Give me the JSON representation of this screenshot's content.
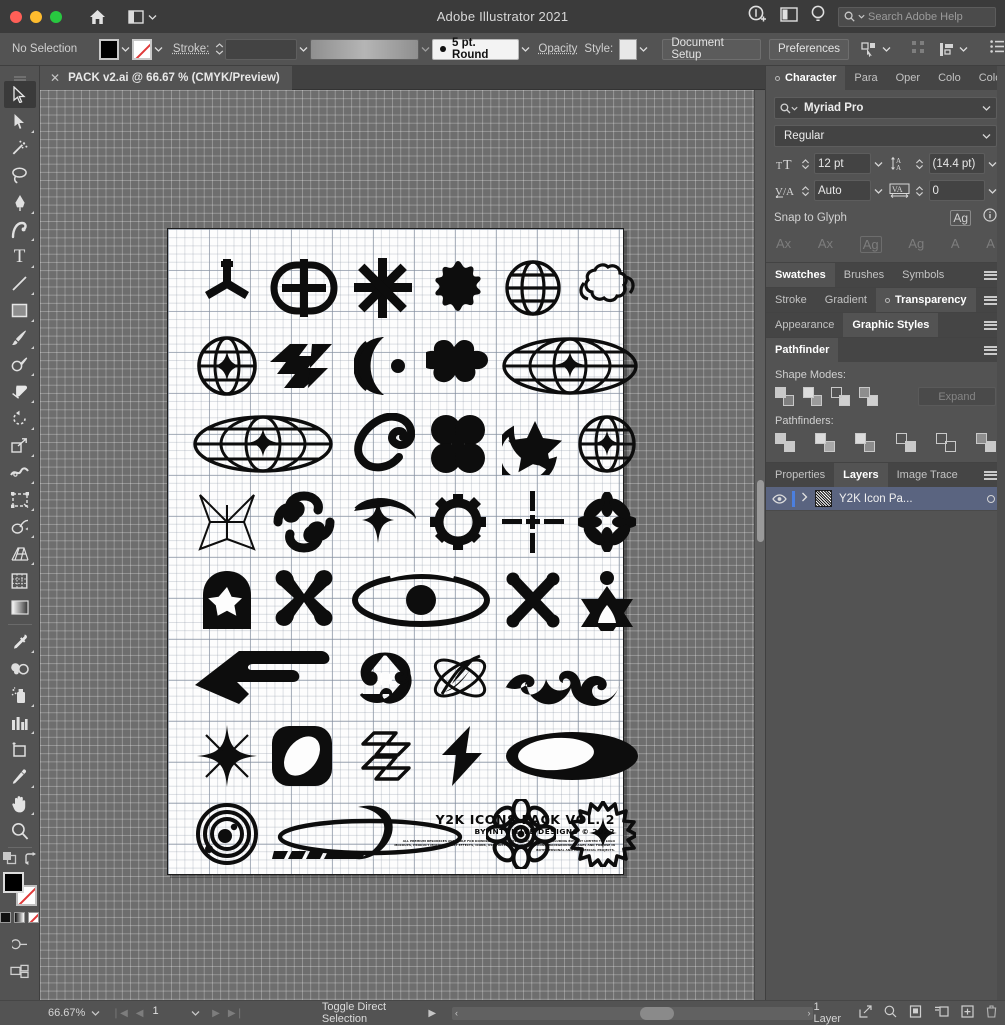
{
  "titlebar": {
    "app_title": "Adobe Illustrator 2021",
    "home_icon": "home-icon",
    "workspace_icon": "workspace-switcher-icon",
    "chevron": "⌄",
    "account_icon": "account-add-icon",
    "screenmode_icon": "screen-mode-icon",
    "discover_icon": "discover-bulb-icon",
    "search_placeholder": "Search Adobe Help",
    "search_icon": "search-icon"
  },
  "controlbar": {
    "selection_status": "No Selection",
    "fill_swatch_label": "fill-swatch",
    "stroke_swatch_label": "stroke-swatch-none",
    "stroke_label": "Stroke:",
    "stroke_weight_value": "",
    "variable_width_profile": "",
    "brush_definition": "5 pt. Round",
    "opacity_label": "Opacity",
    "style_label": "Style:",
    "document_setup_label": "Document Setup",
    "preferences_label": "Preferences",
    "select_similar_icon": "select-similar-icon",
    "align_icon": "align-icon",
    "options_icon": "more-options-icon",
    "transform_icon": "transform-icon"
  },
  "document_tab": {
    "close_icon": "✕",
    "title": "PACK v2.ai @ 66.67 % (CMYK/Preview)"
  },
  "toolbar": {
    "tools": [
      {
        "name": "selection-tool",
        "glyph": "arrow-solid",
        "active": true,
        "has_flyout": false
      },
      {
        "name": "direct-selection-tool",
        "glyph": "arrow-hollow",
        "active": false,
        "has_flyout": true
      },
      {
        "name": "magic-wand-tool",
        "glyph": "wand",
        "active": false,
        "has_flyout": false
      },
      {
        "name": "lasso-tool",
        "glyph": "lasso",
        "active": false,
        "has_flyout": false
      },
      {
        "name": "pen-tool",
        "glyph": "pen",
        "active": false,
        "has_flyout": true
      },
      {
        "name": "curvature-tool",
        "glyph": "curvature",
        "active": false,
        "has_flyout": true
      },
      {
        "name": "type-tool",
        "glyph": "T",
        "active": false,
        "has_flyout": true
      },
      {
        "name": "line-segment-tool",
        "glyph": "line",
        "active": false,
        "has_flyout": true
      },
      {
        "name": "rectangle-tool",
        "glyph": "rect",
        "active": false,
        "has_flyout": true
      },
      {
        "name": "paintbrush-tool",
        "glyph": "brush",
        "active": false,
        "has_flyout": true
      },
      {
        "name": "shaper-tool",
        "glyph": "shaper",
        "active": false,
        "has_flyout": true
      },
      {
        "name": "eraser-tool",
        "glyph": "eraser",
        "active": false,
        "has_flyout": true
      },
      {
        "name": "rotate-tool",
        "glyph": "rotate",
        "active": false,
        "has_flyout": true
      },
      {
        "name": "scale-tool",
        "glyph": "scale",
        "active": false,
        "has_flyout": true
      },
      {
        "name": "width-tool",
        "glyph": "width",
        "active": false,
        "has_flyout": true
      },
      {
        "name": "free-transform-tool",
        "glyph": "free-transform",
        "active": false,
        "has_flyout": false
      },
      {
        "name": "shape-builder-tool",
        "glyph": "shape-builder",
        "active": false,
        "has_flyout": true
      },
      {
        "name": "perspective-grid-tool",
        "glyph": "perspective",
        "active": false,
        "has_flyout": true
      },
      {
        "name": "mesh-tool",
        "glyph": "mesh",
        "active": false,
        "has_flyout": false
      },
      {
        "name": "gradient-tool",
        "glyph": "gradient",
        "active": false,
        "has_flyout": false
      },
      {
        "name": "eyedropper-tool",
        "glyph": "eyedropper",
        "active": false,
        "has_flyout": true
      },
      {
        "name": "blend-tool",
        "glyph": "blend",
        "active": false,
        "has_flyout": false
      },
      {
        "name": "symbol-sprayer-tool",
        "glyph": "symbol-sprayer",
        "active": false,
        "has_flyout": true
      },
      {
        "name": "column-graph-tool",
        "glyph": "graph",
        "active": false,
        "has_flyout": true
      },
      {
        "name": "artboard-tool",
        "glyph": "artboard",
        "active": false,
        "has_flyout": false
      },
      {
        "name": "slice-tool",
        "glyph": "slice",
        "active": false,
        "has_flyout": true
      },
      {
        "name": "hand-tool",
        "glyph": "hand",
        "active": false,
        "has_flyout": true
      },
      {
        "name": "zoom-tool",
        "glyph": "zoom",
        "active": false,
        "has_flyout": false
      }
    ],
    "fill_color": "#000000",
    "stroke_color": "none",
    "swap_icon": "swap-fill-stroke-icon",
    "default_colors_icon": "default-colors-icon",
    "draw_mode_icon": "draw-normal-icon",
    "screen_mode_icon": "change-screen-mode-icon",
    "edit_toolbar_icon": "edit-toolbar-icon"
  },
  "character_panel": {
    "tabs": [
      {
        "label": "Character",
        "selected": true
      },
      {
        "label": "Para",
        "selected": false
      },
      {
        "label": "Oper",
        "selected": false
      },
      {
        "label": "Colo",
        "selected": false
      },
      {
        "label": "Colo",
        "selected": false
      }
    ],
    "font_family": "Myriad Pro",
    "font_style": "Regular",
    "font_size": "12 pt",
    "leading": "(14.4 pt)",
    "kerning": "Auto",
    "tracking": "0",
    "snap_to_glyph_label": "Snap to Glyph",
    "size_icon": "font-size-icon",
    "leading_icon": "leading-icon",
    "kerning_icon": "kerning-icon",
    "tracking_icon": "tracking-icon",
    "glyph_icon": "glyph-align-icon",
    "info_icon": "info-icon",
    "glyph_buttons": [
      "Ax",
      "Ax",
      "Ag",
      "Ag",
      "A",
      "A"
    ]
  },
  "swatches_panel": {
    "tabs": [
      {
        "label": "Swatches",
        "selected": true
      },
      {
        "label": "Brushes",
        "selected": false
      },
      {
        "label": "Symbols",
        "selected": false
      }
    ]
  },
  "stroke_panel": {
    "tabs": [
      {
        "label": "Stroke",
        "selected": false
      },
      {
        "label": "Gradient",
        "selected": false
      },
      {
        "label": "Transparency",
        "selected": true
      }
    ]
  },
  "appearance_panel": {
    "tabs": [
      {
        "label": "Appearance",
        "selected": false
      },
      {
        "label": "Graphic Styles",
        "selected": true
      }
    ]
  },
  "pathfinder_panel": {
    "tabs": [
      {
        "label": "Pathfinder",
        "selected": true
      }
    ],
    "shape_modes_label": "Shape Modes:",
    "pathfinders_label": "Pathfinders:",
    "expand_label": "Expand",
    "shape_modes": [
      "unite",
      "minus-front",
      "intersect",
      "exclude"
    ],
    "pathfinders": [
      "divide",
      "trim",
      "merge",
      "crop",
      "outline",
      "minus-back"
    ]
  },
  "layers_panel": {
    "tabs": [
      {
        "label": "Properties",
        "selected": false
      },
      {
        "label": "Layers",
        "selected": true
      },
      {
        "label": "Image Trace",
        "selected": false
      }
    ],
    "layers": [
      {
        "name": "Y2K Icon Pa...",
        "visible": true,
        "selected": true,
        "eye_icon": "eye-icon",
        "expand_icon": "chevron-right-icon",
        "target_icon": "target-circle-icon"
      }
    ]
  },
  "statusbar": {
    "zoom_level": "66.67%",
    "page_number": "1",
    "current_tool": "Toggle Direct Selection",
    "layer_count": "1 Layer",
    "icons": [
      "share-icon",
      "search-icon",
      "trash-doc-icon",
      "new-layer-sub-icon",
      "new-layer-icon",
      "delete-icon"
    ],
    "nav_first_icon": "first-page-icon",
    "nav_prev_icon": "prev-page-icon",
    "nav_next_icon": "next-page-icon",
    "nav_last_icon": "last-page-icon"
  },
  "artwork": {
    "title": "Y2K ICONS PACK VOL. 2",
    "subtitle": "BY INTUITIVE DESIGNS © 2022",
    "fine_print": "ALL PREMIUM RESOURCES AVAILABLE FOR DOWNLOAD ON INTUITIVE DESIGNS STORE, INCLUDING BUT NOT LIMITED TO: LOGO MOCKUPS, PRODUCT MOCKUPS, TEXT EFFECTS, ICONS, USER INTERFACES, ILLUSTRATIONS, BACKGROUND IMAGES AND FOR USE IN BOTH PERSONAL AND COMMERCIAL PROJECTS.",
    "icon_names": [
      "y-tripod-icon",
      "capsule-cross-icon",
      "eight-point-burst-icon",
      "blob-gear-icon",
      "wire-globe-icon",
      "cloud-orbit-icon",
      "globe-sparkle-icon",
      "zigzag-bars-icon",
      "crescent-dot-icon",
      "puffy-cross-icon",
      "wide-globe-oval-icon",
      "oval-star-grid-icon",
      "ribbon-loop-icon",
      "four-petal-clover-icon",
      "star-crescent-icon",
      "round-globe-grid-icon",
      "thin-starburst-icon",
      "swirl-hook-icon",
      "eye-star-icon",
      "cog-wheel-icon",
      "dashed-crosshair-icon",
      "flower-burst-icon",
      "arch-star-icon",
      "x-blob-icon",
      "eye-ellipse-icon",
      "x-cross-icon",
      "six-star-figure-icon",
      "arrow-sweep-icon",
      "pinwheel-icon",
      "atom-swirl-icon",
      "tribal-wave-icon",
      "four-point-sparkle-icon",
      "rounded-square-hole-icon",
      "outline-zigzag-icon",
      "lightning-bolt-icon",
      "ellipse-eclipse-icon",
      "concentric-orbit-icon",
      "ringed-planet-icon",
      "flower-eye-icon",
      "jagged-sun-icon"
    ]
  }
}
